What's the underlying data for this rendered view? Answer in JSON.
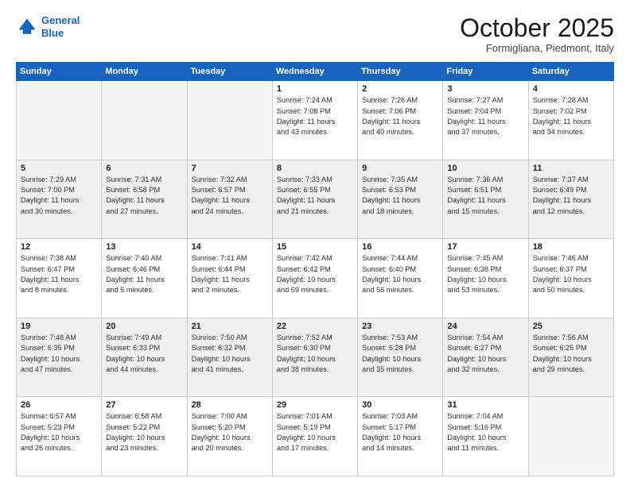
{
  "header": {
    "logo_line1": "General",
    "logo_line2": "Blue",
    "month": "October 2025",
    "location": "Formigliana, Piedmont, Italy"
  },
  "weekdays": [
    "Sunday",
    "Monday",
    "Tuesday",
    "Wednesday",
    "Thursday",
    "Friday",
    "Saturday"
  ],
  "rows": [
    {
      "shaded": false,
      "days": [
        {
          "num": "",
          "info": ""
        },
        {
          "num": "",
          "info": ""
        },
        {
          "num": "",
          "info": ""
        },
        {
          "num": "1",
          "info": "Sunrise: 7:24 AM\nSunset: 7:08 PM\nDaylight: 11 hours\nand 43 minutes."
        },
        {
          "num": "2",
          "info": "Sunrise: 7:26 AM\nSunset: 7:06 PM\nDaylight: 11 hours\nand 40 minutes."
        },
        {
          "num": "3",
          "info": "Sunrise: 7:27 AM\nSunset: 7:04 PM\nDaylight: 11 hours\nand 37 minutes."
        },
        {
          "num": "4",
          "info": "Sunrise: 7:28 AM\nSunset: 7:02 PM\nDaylight: 11 hours\nand 34 minutes."
        }
      ]
    },
    {
      "shaded": true,
      "days": [
        {
          "num": "5",
          "info": "Sunrise: 7:29 AM\nSunset: 7:00 PM\nDaylight: 11 hours\nand 30 minutes."
        },
        {
          "num": "6",
          "info": "Sunrise: 7:31 AM\nSunset: 6:58 PM\nDaylight: 11 hours\nand 27 minutes."
        },
        {
          "num": "7",
          "info": "Sunrise: 7:32 AM\nSunset: 6:57 PM\nDaylight: 11 hours\nand 24 minutes."
        },
        {
          "num": "8",
          "info": "Sunrise: 7:33 AM\nSunset: 6:55 PM\nDaylight: 11 hours\nand 21 minutes."
        },
        {
          "num": "9",
          "info": "Sunrise: 7:35 AM\nSunset: 6:53 PM\nDaylight: 11 hours\nand 18 minutes."
        },
        {
          "num": "10",
          "info": "Sunrise: 7:36 AM\nSunset: 6:51 PM\nDaylight: 11 hours\nand 15 minutes."
        },
        {
          "num": "11",
          "info": "Sunrise: 7:37 AM\nSunset: 6:49 PM\nDaylight: 11 hours\nand 12 minutes."
        }
      ]
    },
    {
      "shaded": false,
      "days": [
        {
          "num": "12",
          "info": "Sunrise: 7:38 AM\nSunset: 6:47 PM\nDaylight: 11 hours\nand 8 minutes."
        },
        {
          "num": "13",
          "info": "Sunrise: 7:40 AM\nSunset: 6:46 PM\nDaylight: 11 hours\nand 5 minutes."
        },
        {
          "num": "14",
          "info": "Sunrise: 7:41 AM\nSunset: 6:44 PM\nDaylight: 11 hours\nand 2 minutes."
        },
        {
          "num": "15",
          "info": "Sunrise: 7:42 AM\nSunset: 6:42 PM\nDaylight: 10 hours\nand 59 minutes."
        },
        {
          "num": "16",
          "info": "Sunrise: 7:44 AM\nSunset: 6:40 PM\nDaylight: 10 hours\nand 56 minutes."
        },
        {
          "num": "17",
          "info": "Sunrise: 7:45 AM\nSunset: 6:38 PM\nDaylight: 10 hours\nand 53 minutes."
        },
        {
          "num": "18",
          "info": "Sunrise: 7:46 AM\nSunset: 6:37 PM\nDaylight: 10 hours\nand 50 minutes."
        }
      ]
    },
    {
      "shaded": true,
      "days": [
        {
          "num": "19",
          "info": "Sunrise: 7:48 AM\nSunset: 6:35 PM\nDaylight: 10 hours\nand 47 minutes."
        },
        {
          "num": "20",
          "info": "Sunrise: 7:49 AM\nSunset: 6:33 PM\nDaylight: 10 hours\nand 44 minutes."
        },
        {
          "num": "21",
          "info": "Sunrise: 7:50 AM\nSunset: 6:32 PM\nDaylight: 10 hours\nand 41 minutes."
        },
        {
          "num": "22",
          "info": "Sunrise: 7:52 AM\nSunset: 6:30 PM\nDaylight: 10 hours\nand 38 minutes."
        },
        {
          "num": "23",
          "info": "Sunrise: 7:53 AM\nSunset: 6:28 PM\nDaylight: 10 hours\nand 35 minutes."
        },
        {
          "num": "24",
          "info": "Sunrise: 7:54 AM\nSunset: 6:27 PM\nDaylight: 10 hours\nand 32 minutes."
        },
        {
          "num": "25",
          "info": "Sunrise: 7:56 AM\nSunset: 6:25 PM\nDaylight: 10 hours\nand 29 minutes."
        }
      ]
    },
    {
      "shaded": false,
      "days": [
        {
          "num": "26",
          "info": "Sunrise: 6:57 AM\nSunset: 5:23 PM\nDaylight: 10 hours\nand 26 minutes."
        },
        {
          "num": "27",
          "info": "Sunrise: 6:58 AM\nSunset: 5:22 PM\nDaylight: 10 hours\nand 23 minutes."
        },
        {
          "num": "28",
          "info": "Sunrise: 7:00 AM\nSunset: 5:20 PM\nDaylight: 10 hours\nand 20 minutes."
        },
        {
          "num": "29",
          "info": "Sunrise: 7:01 AM\nSunset: 5:19 PM\nDaylight: 10 hours\nand 17 minutes."
        },
        {
          "num": "30",
          "info": "Sunrise: 7:03 AM\nSunset: 5:17 PM\nDaylight: 10 hours\nand 14 minutes."
        },
        {
          "num": "31",
          "info": "Sunrise: 7:04 AM\nSunset: 5:16 PM\nDaylight: 10 hours\nand 11 minutes."
        },
        {
          "num": "",
          "info": ""
        }
      ]
    }
  ]
}
